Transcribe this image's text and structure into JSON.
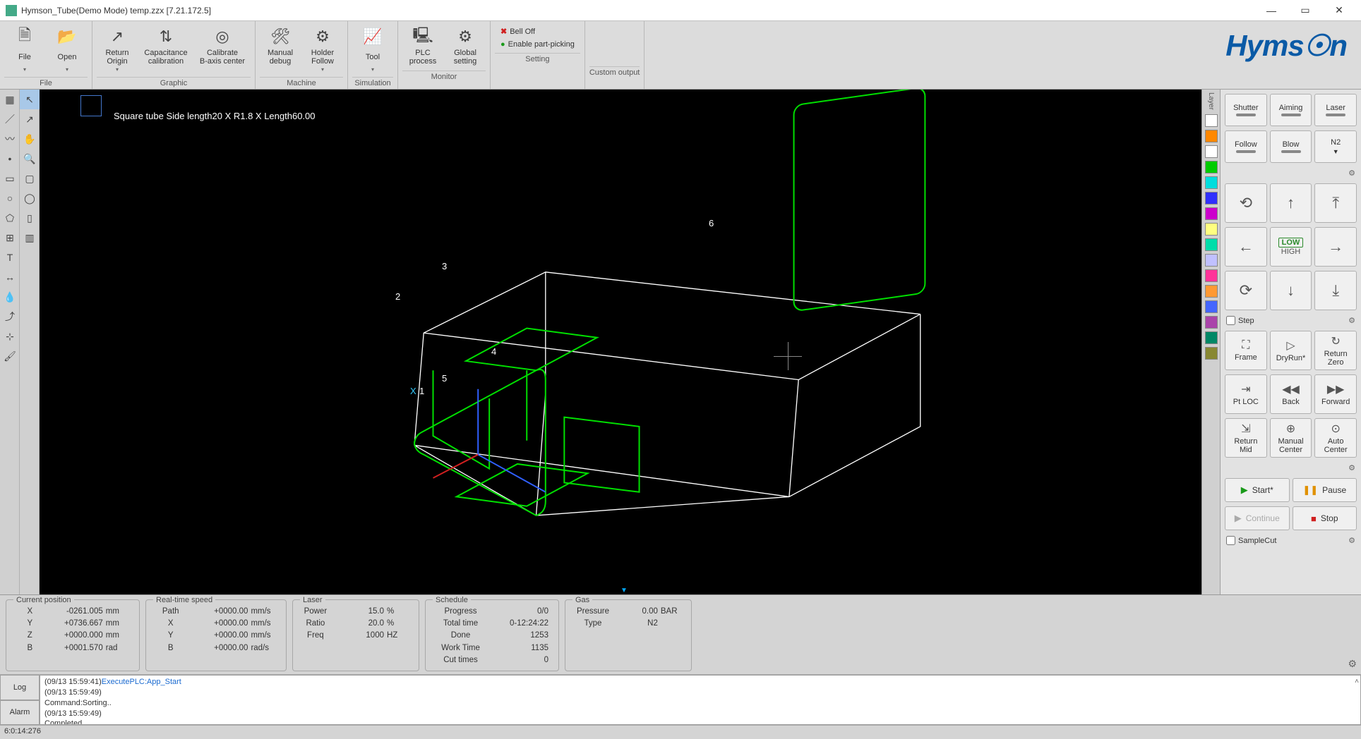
{
  "titlebar": {
    "title": "Hymson_Tube(Demo Mode) temp.zzx  [7.21.172.5]"
  },
  "ribbon": {
    "file": {
      "label": "File",
      "file_btn": "File",
      "open_btn": "Open"
    },
    "graphic": {
      "label": "Graphic",
      "return_origin": "Return\nOrigin",
      "cap_cal": "Capacitance\ncalibration",
      "cal_baxis": "Calibrate\nB-axis center"
    },
    "machine": {
      "label": "Machine",
      "manual_debug": "Manual\ndebug",
      "holder_follow": "Holder\nFollow"
    },
    "simulation": {
      "label": "Simulation",
      "tool": "Tool"
    },
    "monitor": {
      "label": "Monitor",
      "plc_process": "PLC\nprocess",
      "global_setting": "Global\nsetting"
    },
    "setting": {
      "label": "Setting",
      "bell_off": "Bell Off",
      "enable_pick": "Enable part-picking"
    },
    "custom": {
      "label": "Custom output"
    },
    "logo": "Hyms☉n"
  },
  "viewport": {
    "tube_label": "Square tube Side length20 X R1.8 X Length60.00",
    "nums": [
      "1",
      "2",
      "3",
      "4",
      "5",
      "6"
    ],
    "axis_x": "X"
  },
  "layer_colors": [
    "#ffffff",
    "#ff8800",
    "#ffffff",
    "#00cc00",
    "#00dddd",
    "#3030ff",
    "#cc00cc",
    "#ffff80",
    "#00ddaa",
    "#c0c0ff",
    "#ff3399",
    "#ff9933",
    "#4466ff",
    "#aa44aa",
    "#008866",
    "#888833"
  ],
  "right": {
    "row1": [
      "Shutter",
      "Aiming",
      "Laser"
    ],
    "row2": [
      "Follow",
      "Blow",
      "N2"
    ],
    "low": "LOW",
    "high": "HIGH",
    "step_label": "Step",
    "act1": [
      {
        "icon": "⛶",
        "label": "Frame"
      },
      {
        "icon": "▷",
        "label": "DryRun*"
      },
      {
        "icon": "↻",
        "label": "Return\nZero"
      }
    ],
    "act2": [
      {
        "icon": "⇥",
        "label": "Pt LOC"
      },
      {
        "icon": "◀◀",
        "label": "Back"
      },
      {
        "icon": "▶▶",
        "label": "Forward"
      }
    ],
    "act3": [
      {
        "icon": "⇲",
        "label": "Return\nMid"
      },
      {
        "icon": "⊕",
        "label": "Manual\nCenter"
      },
      {
        "icon": "⊙",
        "label": "Auto\nCenter"
      }
    ],
    "ctrl": {
      "start": "Start*",
      "pause": "Pause",
      "continue": "Continue",
      "stop": "Stop"
    },
    "samplecut": "SampleCut"
  },
  "status": {
    "pos": {
      "title": "Current position",
      "rows": [
        {
          "k": "X",
          "v": "-0261.005",
          "u": "mm"
        },
        {
          "k": "Y",
          "v": "+0736.667",
          "u": "mm"
        },
        {
          "k": "Z",
          "v": "+0000.000",
          "u": "mm"
        },
        {
          "k": "B",
          "v": "+0001.570",
          "u": "rad"
        }
      ]
    },
    "speed": {
      "title": "Real-time speed",
      "rows": [
        {
          "k": "Path",
          "v": "+0000.00",
          "u": "mm/s"
        },
        {
          "k": "X",
          "v": "+0000.00",
          "u": "mm/s"
        },
        {
          "k": "Y",
          "v": "+0000.00",
          "u": "mm/s"
        },
        {
          "k": "B",
          "v": "+0000.00",
          "u": "rad/s"
        }
      ]
    },
    "laser": {
      "title": "Laser",
      "rows": [
        {
          "k": "Power",
          "v": "15.0",
          "u": "%"
        },
        {
          "k": "Ratio",
          "v": "20.0",
          "u": "%"
        },
        {
          "k": "Freq",
          "v": "1000",
          "u": "HZ"
        }
      ]
    },
    "schedule": {
      "title": "Schedule",
      "rows": [
        {
          "k": "Progress",
          "v": "0/0"
        },
        {
          "k": "Total time",
          "v": "0-12:24:22"
        },
        {
          "k": "Done",
          "v": "1253"
        },
        {
          "k": "Work Time",
          "v": "1135"
        },
        {
          "k": "Cut times",
          "v": "0"
        }
      ]
    },
    "gas": {
      "title": "Gas",
      "rows": [
        {
          "k": "Pressure",
          "v": "0.00",
          "u": "BAR"
        },
        {
          "k": "Type",
          "v": "N2",
          "u": ""
        }
      ]
    }
  },
  "log": {
    "tab_log": "Log",
    "tab_alarm": "Alarm",
    "l1_ts": "(09/13 15:59:41)",
    "l1_msg": "ExecutePLC:App_Start",
    "l2": "(09/13 15:59:49)",
    "l3": "Command:Sorting..",
    "l4": "(09/13 15:59:49)",
    "l5": "Completed"
  },
  "footer": {
    "left": "6:0:14:276"
  }
}
